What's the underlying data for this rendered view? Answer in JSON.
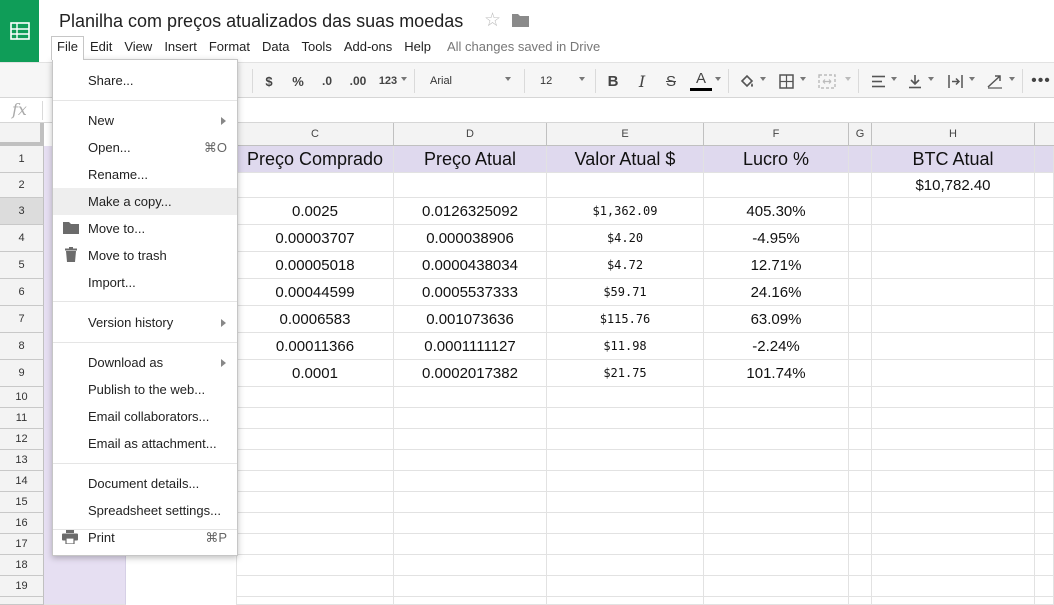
{
  "header": {
    "title": "Planilha com preços atualizados das suas moedas",
    "save_status": "All changes saved in Drive"
  },
  "menu": {
    "items": [
      "File",
      "Edit",
      "View",
      "Insert",
      "Format",
      "Data",
      "Tools",
      "Add-ons",
      "Help"
    ],
    "active": "File"
  },
  "toolbar": {
    "currency": "$",
    "percent": "%",
    "decrease_decimals": ".0",
    "increase_decimals": ".00",
    "more_formats": "123",
    "font": "Arial",
    "font_size": "12",
    "bold": "B",
    "italic": "I",
    "strikethrough": "S",
    "text_color": "A",
    "text_color_value": "#000000"
  },
  "formula_bar": {
    "fx_label": "fx",
    "value": ""
  },
  "columns": [
    "C",
    "D",
    "E",
    "F",
    "G",
    "H"
  ],
  "rows": [
    "1",
    "2",
    "3",
    "4",
    "5",
    "6",
    "7",
    "8",
    "9",
    "10",
    "11",
    "12",
    "13",
    "14",
    "15",
    "16",
    "17",
    "18",
    "19"
  ],
  "table": {
    "headers": {
      "preco_comprado": "Preço Comprado",
      "preco_atual": "Preço Atual",
      "valor_atual": "Valor Atual $",
      "lucro": "Lucro %",
      "btc_atual": "BTC Atual"
    },
    "btc_value": "$10,782.40",
    "data_rows": [
      {
        "c": "0.0025",
        "d": "0.0126325092",
        "e": "$1,362.09",
        "f": "405.30%"
      },
      {
        "c": "0.00003707",
        "d": "0.000038906",
        "e": "$4.20",
        "f": "-4.95%"
      },
      {
        "c": "0.00005018",
        "d": "0.0000438034",
        "e": "$4.72",
        "f": "12.71%"
      },
      {
        "c": "0.00044599",
        "d": "0.0005537333",
        "e": "$59.71",
        "f": "24.16%"
      },
      {
        "c": "0.0006583",
        "d": "0.001073636",
        "e": "$115.76",
        "f": "63.09%"
      },
      {
        "c": "0.00011366",
        "d": "0.0001111127",
        "e": "$11.98",
        "f": "-2.24%"
      },
      {
        "c": "0.0001",
        "d": "0.0002017382",
        "e": "$21.75",
        "f": "101.74%"
      }
    ]
  },
  "file_menu": {
    "share": "Share...",
    "new": "New",
    "open": "Open...",
    "open_shortcut": "⌘O",
    "rename": "Rename...",
    "make_copy": "Make a copy...",
    "move_to": "Move to...",
    "move_to_trash": "Move to trash",
    "import": "Import...",
    "version_history": "Version history",
    "download_as": "Download as",
    "publish": "Publish to the web...",
    "email_collaborators": "Email collaborators...",
    "email_attachment": "Email as attachment...",
    "document_details": "Document details...",
    "spreadsheet_settings": "Spreadsheet settings...",
    "print": "Print",
    "print_shortcut": "⌘P"
  },
  "colors": {
    "brand_green": "#0f9d58",
    "header_fill": "#dfd9ee",
    "column_b_fill": "#e6dff2"
  }
}
